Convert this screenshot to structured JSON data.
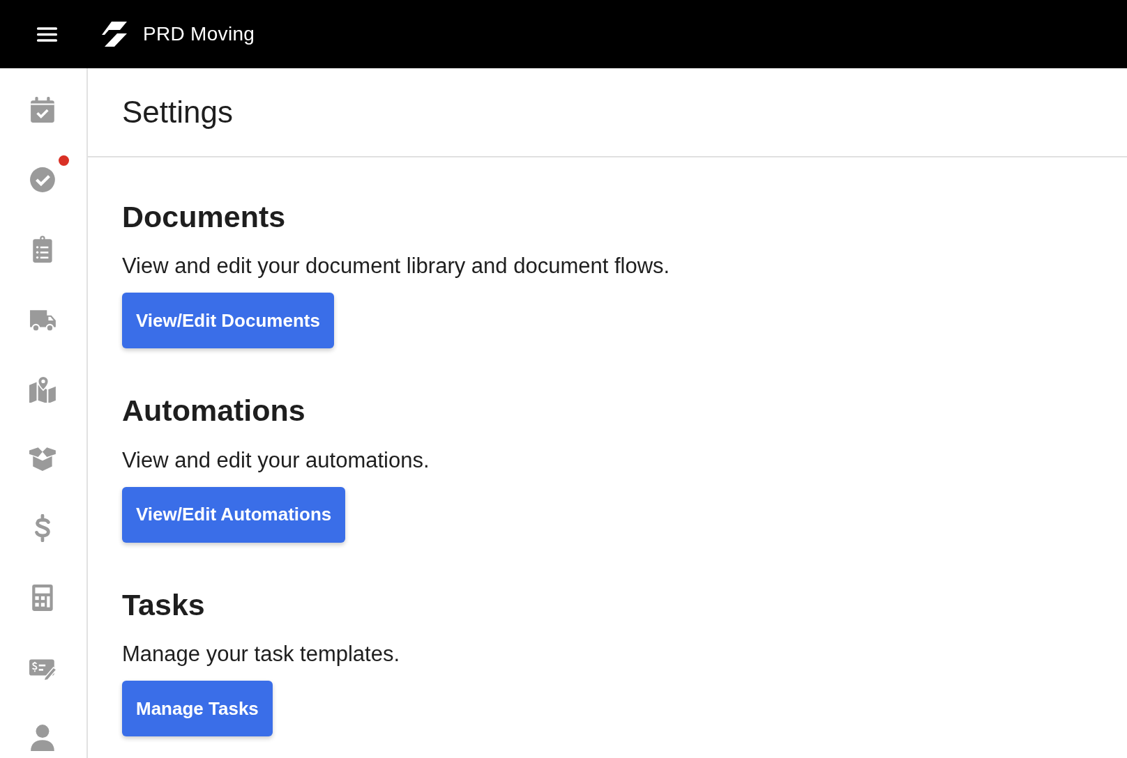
{
  "top_bar": {
    "brand": "PRD Moving"
  },
  "sidebar": {
    "items": [
      {
        "notification": false
      },
      {
        "notification": true
      },
      {
        "notification": false
      },
      {
        "notification": false
      },
      {
        "notification": false
      },
      {
        "notification": false
      },
      {
        "notification": false
      },
      {
        "notification": false
      },
      {
        "notification": false
      },
      {
        "notification": false
      }
    ]
  },
  "page": {
    "title": "Settings"
  },
  "sections": [
    {
      "heading": "Documents",
      "description": "View and edit your document library and document flows.",
      "button": "View/Edit Documents"
    },
    {
      "heading": "Automations",
      "description": "View and edit your automations.",
      "button": "View/Edit Automations"
    },
    {
      "heading": "Tasks",
      "description": "Manage your task templates.",
      "button": "Manage Tasks"
    }
  ]
}
